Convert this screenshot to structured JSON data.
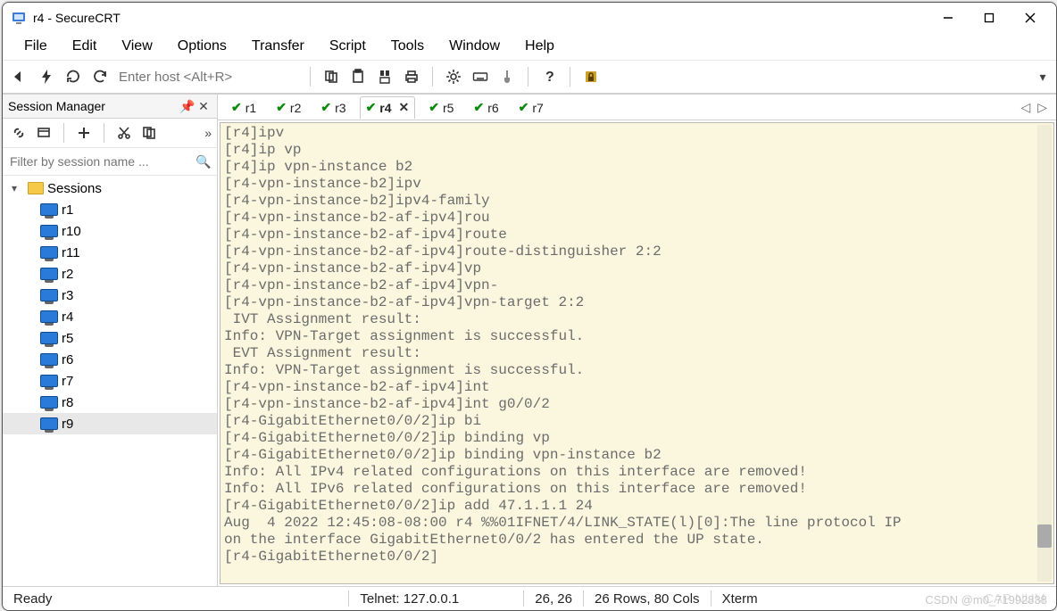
{
  "titlebar": {
    "title": "r4 - SecureCRT"
  },
  "menu": [
    "File",
    "Edit",
    "View",
    "Options",
    "Transfer",
    "Script",
    "Tools",
    "Window",
    "Help"
  ],
  "toolbar": {
    "host_placeholder": "Enter host <Alt+R>"
  },
  "session_manager": {
    "title": "Session Manager",
    "filter_placeholder": "Filter by session name ...",
    "root": "Sessions",
    "items": [
      "r1",
      "r10",
      "r11",
      "r2",
      "r3",
      "r4",
      "r5",
      "r6",
      "r7",
      "r8",
      "r9"
    ],
    "selected": "r9"
  },
  "tabs": {
    "items": [
      {
        "label": "r1"
      },
      {
        "label": "r2"
      },
      {
        "label": "r3"
      },
      {
        "label": "r4",
        "active": true
      },
      {
        "label": "r5"
      },
      {
        "label": "r6"
      },
      {
        "label": "r7"
      }
    ]
  },
  "terminal": {
    "lines": [
      "[r4]ipv",
      "[r4]ip vp",
      "[r4]ip vpn-instance b2",
      "[r4-vpn-instance-b2]ipv",
      "[r4-vpn-instance-b2]ipv4-family",
      "[r4-vpn-instance-b2-af-ipv4]rou",
      "[r4-vpn-instance-b2-af-ipv4]route",
      "[r4-vpn-instance-b2-af-ipv4]route-distinguisher 2:2",
      "[r4-vpn-instance-b2-af-ipv4]vp",
      "[r4-vpn-instance-b2-af-ipv4]vpn-",
      "[r4-vpn-instance-b2-af-ipv4]vpn-target 2:2",
      " IVT Assignment result:",
      "Info: VPN-Target assignment is successful.",
      " EVT Assignment result:",
      "Info: VPN-Target assignment is successful.",
      "[r4-vpn-instance-b2-af-ipv4]int",
      "[r4-vpn-instance-b2-af-ipv4]int g0/0/2",
      "[r4-GigabitEthernet0/0/2]ip bi",
      "[r4-GigabitEthernet0/0/2]ip binding vp",
      "[r4-GigabitEthernet0/0/2]ip binding vpn-instance b2",
      "Info: All IPv4 related configurations on this interface are removed!",
      "Info: All IPv6 related configurations on this interface are removed!",
      "[r4-GigabitEthernet0/0/2]ip add 47.1.1.1 24",
      "Aug  4 2022 12:45:08-08:00 r4 %%01IFNET/4/LINK_STATE(l)[0]:The line protocol IP",
      "on the interface GigabitEthernet0/0/2 has entered the UP state.",
      "[r4-GigabitEthernet0/0/2]"
    ]
  },
  "statusbar": {
    "ready": "Ready",
    "connection": "Telnet: 127.0.0.1",
    "cursor": "26,  26",
    "size": "26 Rows, 80 Cols",
    "term_type": "Xterm",
    "caps": "CAP  NUM"
  },
  "watermark": "CSDN @m0_71992838"
}
